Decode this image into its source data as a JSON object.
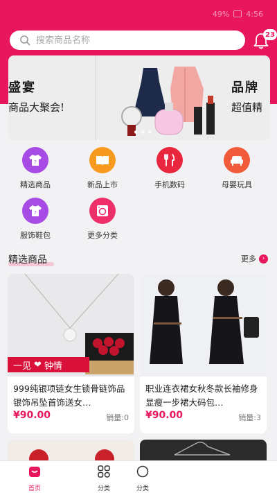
{
  "status_bar": {
    "time": "4:56",
    "battery": "49%"
  },
  "search": {
    "placeholder": "搜索商品名称"
  },
  "notifications": {
    "count": "23"
  },
  "banner": {
    "left_line1": "盛宴",
    "left_line2": "商品大聚会!",
    "right_line1": "品牌",
    "right_line2": "超值精"
  },
  "categories": [
    {
      "label": "精选商品",
      "icon": "shirt-icon",
      "color": "#a64be3"
    },
    {
      "label": "新品上市",
      "icon": "book-icon",
      "color": "#f79a1d"
    },
    {
      "label": "手机数码",
      "icon": "fork-knife-icon",
      "color": "#e8263e"
    },
    {
      "label": "母婴玩具",
      "icon": "sofa-icon",
      "color": "#f25b3a"
    },
    {
      "label": "服饰鞋包",
      "icon": "shirt-icon",
      "color": "#a64be3"
    },
    {
      "label": "更多分类",
      "icon": "washer-icon",
      "color": "#ee2f6a"
    }
  ],
  "featured": {
    "title": "精选商品",
    "more_label": "更多"
  },
  "products": [
    {
      "title": "999纯银项链女生锁骨链饰品银饰吊坠首饰送女…",
      "price": "¥90.00",
      "sales": "销量:0",
      "ribbon_text_1": "一见",
      "ribbon_text_2": "钟情"
    },
    {
      "title": "职业连衣裙女秋冬款长袖修身显瘦一步裙大码包…",
      "price": "¥90.00",
      "sales": "销量:3"
    }
  ],
  "bottom_nav": [
    {
      "label": "首页",
      "active": true
    },
    {
      "label": "分类",
      "active": false
    },
    {
      "label": "分类",
      "active": false
    }
  ],
  "colors": {
    "brand": "#e8175d",
    "background": "#f2f2f4"
  }
}
